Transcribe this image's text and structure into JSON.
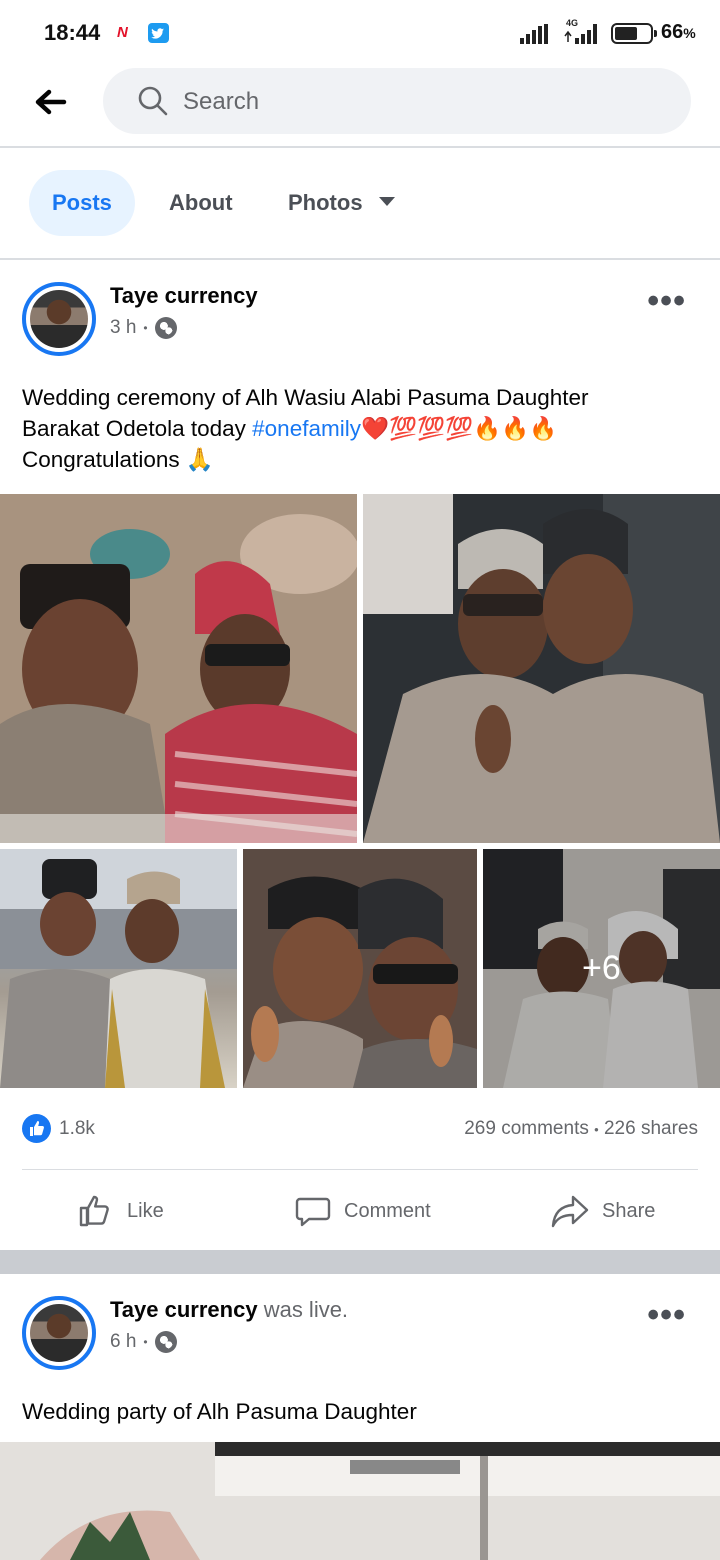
{
  "status_bar": {
    "time": "18:44",
    "network": "4G",
    "battery": "66",
    "battery_suffix": "%",
    "battery_level": 0.66
  },
  "header": {
    "search_placeholder": "Search"
  },
  "tabs": [
    {
      "label": "Posts",
      "active": true
    },
    {
      "label": "About",
      "active": false
    },
    {
      "label": "Photos",
      "active": false
    }
  ],
  "post1": {
    "author": "Taye currency",
    "time": "3 h",
    "dot": "•",
    "text_line1": "Wedding ceremony of Alh Wasiu Alabi  Pasuma Daughter",
    "text_line2_start": "Barakat Odetola today ",
    "hashtag": "#onefamily",
    "emojis": "❤️💯💯💯🔥🔥🔥",
    "text_line3": "Congratulations 🙏",
    "more_photos": "+6",
    "likes": "1.8k",
    "comments": "269 comments",
    "shares": "226 shares",
    "separator": "•"
  },
  "actions": {
    "like": "Like",
    "comment": "Comment",
    "share": "Share"
  },
  "post2": {
    "author": "Taye currency",
    "author_suffix": " was live.",
    "time": "6 h",
    "dot": "•",
    "text": "Wedding party of Alh Pasuma Daughter"
  },
  "colors": {
    "accent": "#1877f2",
    "secondary_text": "#65676b",
    "tab_active_bg": "#e7f3ff"
  }
}
